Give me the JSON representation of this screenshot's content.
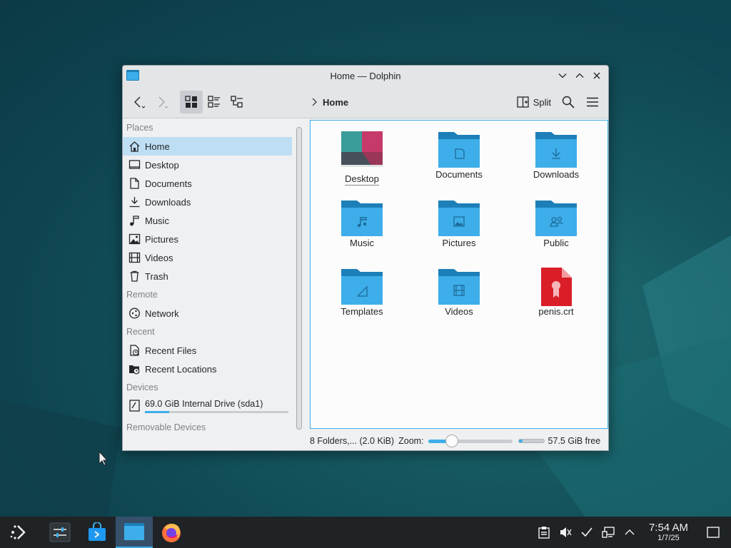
{
  "window": {
    "title": "Home — Dolphin"
  },
  "toolbar": {
    "breadcrumb": "Home",
    "split_label": "Split"
  },
  "places": {
    "sections": {
      "places": "Places",
      "remote": "Remote",
      "recent": "Recent",
      "devices": "Devices",
      "removable": "Removable Devices"
    },
    "items": [
      {
        "label": "Home",
        "icon": "home-icon",
        "selected": true
      },
      {
        "label": "Desktop",
        "icon": "desktop-icon"
      },
      {
        "label": "Documents",
        "icon": "documents-icon"
      },
      {
        "label": "Downloads",
        "icon": "downloads-icon"
      },
      {
        "label": "Music",
        "icon": "music-icon"
      },
      {
        "label": "Pictures",
        "icon": "pictures-icon"
      },
      {
        "label": "Videos",
        "icon": "videos-icon"
      },
      {
        "label": "Trash",
        "icon": "trash-icon"
      }
    ],
    "remote": [
      {
        "label": "Network",
        "icon": "network-icon"
      }
    ],
    "recent": [
      {
        "label": "Recent Files",
        "icon": "recent-files-icon"
      },
      {
        "label": "Recent Locations",
        "icon": "recent-locations-icon"
      }
    ],
    "devices": [
      {
        "label": "69.0 GiB Internal Drive (sda1)",
        "icon": "drive-icon",
        "used_fraction": 0.17
      }
    ]
  },
  "files": [
    {
      "name": "Desktop",
      "type": "desktop-folder"
    },
    {
      "name": "Documents",
      "type": "folder",
      "emblem": "document"
    },
    {
      "name": "Downloads",
      "type": "folder",
      "emblem": "download"
    },
    {
      "name": "Music",
      "type": "folder",
      "emblem": "music"
    },
    {
      "name": "Pictures",
      "type": "folder",
      "emblem": "picture"
    },
    {
      "name": "Public",
      "type": "folder",
      "emblem": "users"
    },
    {
      "name": "Templates",
      "type": "folder",
      "emblem": "template"
    },
    {
      "name": "Videos",
      "type": "folder",
      "emblem": "video"
    },
    {
      "name": "penis.crt",
      "type": "certificate"
    }
  ],
  "status": {
    "summary": "8 Folders,... (2.0 KiB)",
    "zoom_label": "Zoom:",
    "zoom_fraction": 0.28,
    "free_space": "57.5 GiB free",
    "used_fraction": 0.17
  },
  "taskbar": {
    "apps": [
      {
        "name": "app-launcher",
        "icon": "kde-launcher-icon"
      },
      {
        "name": "system-settings",
        "icon": "settings-icon"
      },
      {
        "name": "discover",
        "icon": "store-icon"
      },
      {
        "name": "dolphin",
        "icon": "folder-icon",
        "active": true
      },
      {
        "name": "firefox",
        "icon": "firefox-icon"
      }
    ],
    "clock": {
      "time": "7:54 AM",
      "date": "1/7/25"
    }
  },
  "colors": {
    "accent": "#3daee9",
    "folder": "#3daee9",
    "folder_dark": "#1d7fb8",
    "selection": "#bedef3",
    "taskbar": "#1f2326"
  }
}
